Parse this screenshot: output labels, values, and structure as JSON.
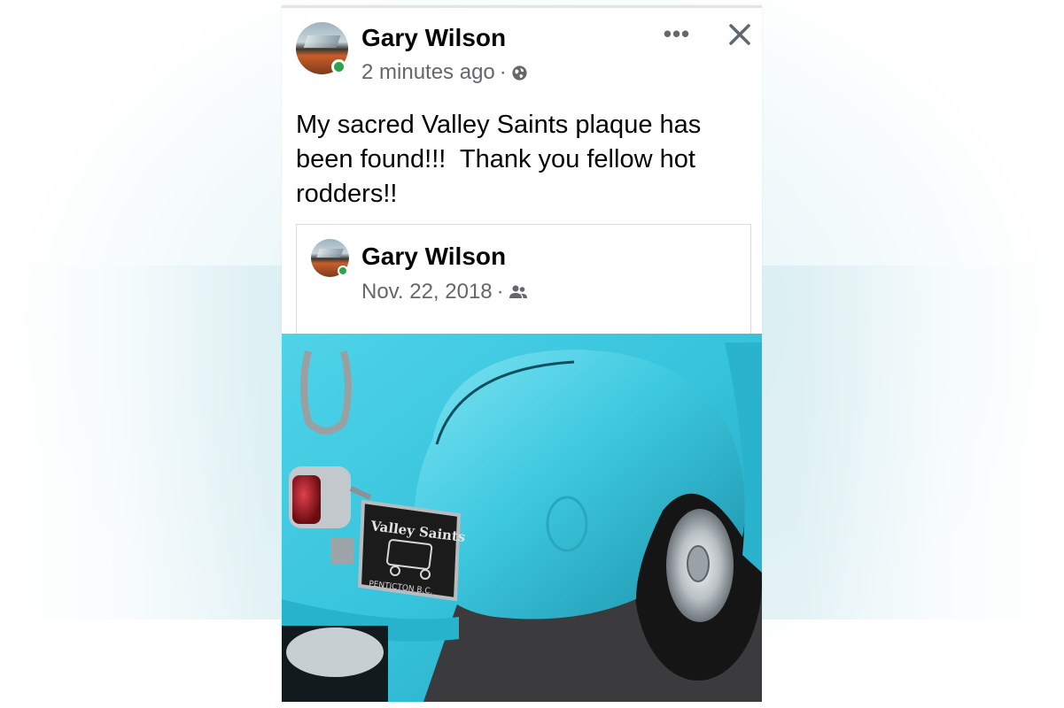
{
  "post": {
    "author": "Gary Wilson",
    "timestamp": "2 minutes ago",
    "separator": "·",
    "privacy_icon": "globe-icon",
    "text": "My sacred Valley Saints plaque has been found!!!  Thank you fellow hot rodders!!",
    "more_label": "•••",
    "close_icon": "close-icon"
  },
  "shared_post": {
    "author": "Gary Wilson",
    "date": "Nov. 22, 2018",
    "separator": "·",
    "privacy_icon": "friends-icon"
  },
  "photo": {
    "plaque_title": "Valley Saints",
    "plaque_location": "PENTICTON B.C."
  },
  "colors": {
    "name_text": "#050505",
    "meta_text": "#65676b",
    "online": "#31a24c",
    "truck_paint": "#35c6df"
  }
}
